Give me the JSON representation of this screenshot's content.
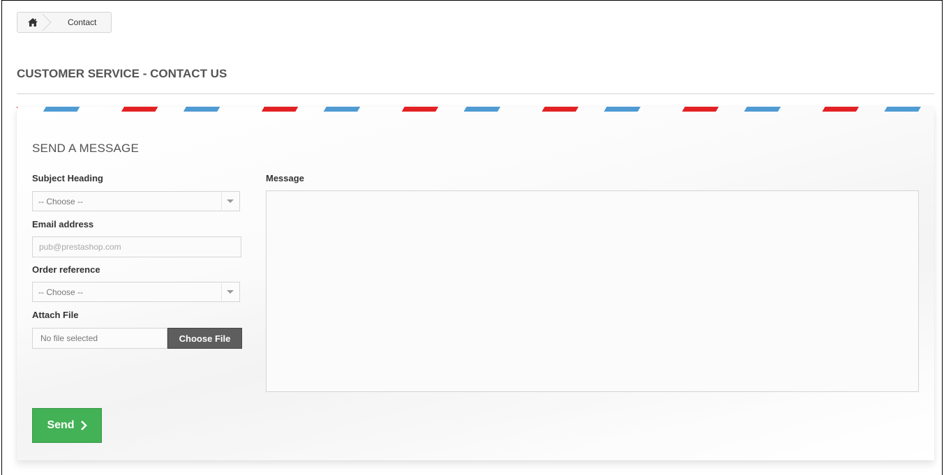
{
  "breadcrumb": {
    "home_icon": "home-icon",
    "current": "Contact"
  },
  "page_heading": "CUSTOMER SERVICE - CONTACT US",
  "form": {
    "title": "SEND A MESSAGE",
    "subject_label": "Subject Heading",
    "subject_value": "-- Choose --",
    "email_label": "Email address",
    "email_placeholder": "pub@prestashop.com",
    "order_label": "Order reference",
    "order_value": "-- Choose --",
    "attach_label": "Attach File",
    "file_status": "No file selected",
    "file_button": "Choose File",
    "message_label": "Message",
    "message_value": "",
    "send_label": "Send"
  },
  "colors": {
    "send_green": "#43b155",
    "stripe_blue": "#4f9bd3",
    "stripe_red": "#e32124",
    "file_button_gray": "#5e5e5e"
  }
}
